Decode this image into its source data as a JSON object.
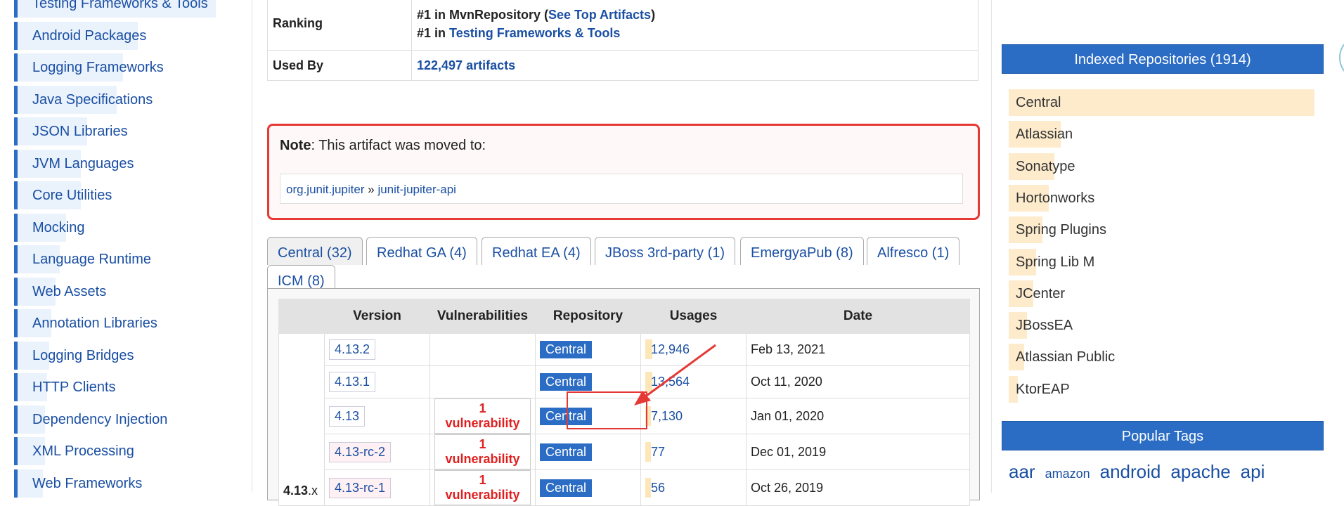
{
  "sidebar": {
    "categories": [
      {
        "label": "Testing Frameworks & Tools",
        "fill": 0.94
      },
      {
        "label": "Android Packages",
        "fill": 0.57
      },
      {
        "label": "Logging Frameworks",
        "fill": 0.5
      },
      {
        "label": "Java Specifications",
        "fill": 0.47
      },
      {
        "label": "JSON Libraries",
        "fill": 0.33
      },
      {
        "label": "JVM Languages",
        "fill": 0.3
      },
      {
        "label": "Core Utilities",
        "fill": 0.3
      },
      {
        "label": "Mocking",
        "fill": 0.23
      },
      {
        "label": "Language Runtime",
        "fill": 0.2
      },
      {
        "label": "Web Assets",
        "fill": 0.18
      },
      {
        "label": "Annotation Libraries",
        "fill": 0.16
      },
      {
        "label": "Logging Bridges",
        "fill": 0.15
      },
      {
        "label": "HTTP Clients",
        "fill": 0.14
      },
      {
        "label": "Dependency Injection",
        "fill": 0.13
      },
      {
        "label": "XML Processing",
        "fill": 0.13
      },
      {
        "label": "Web Frameworks",
        "fill": 0.12
      }
    ]
  },
  "info": {
    "ranking_label": "Ranking",
    "rank1_prefix": "#1 in MvnRepository (",
    "rank1_link": "See Top Artifacts",
    "rank1_suffix": ")",
    "rank2_prefix": "#1 in",
    "rank2_link": "Testing Frameworks & Tools",
    "usedby_label": "Used By",
    "usedby_value": "122,497 artifacts"
  },
  "note": {
    "label": "Note",
    "text": ": This artifact was moved to:",
    "group": "org.junit.jupiter",
    "sep": "»",
    "artifact": "junit-jupiter-api"
  },
  "tabs": [
    "Central (32)",
    "Redhat GA (4)",
    "Redhat EA (4)",
    "JBoss 3rd-party (1)",
    "EmergyaPub (8)",
    "Alfresco (1)",
    "ICM (8)"
  ],
  "versions": {
    "headers": [
      "Version",
      "Vulnerabilities",
      "Repository",
      "Usages",
      "Date"
    ],
    "group_label": "4.13.x",
    "group_bold": "4.13",
    "group_suffix": ".x",
    "rows": [
      {
        "version": "4.13.2",
        "vuln": "",
        "repo": "Central",
        "usages": "12,946",
        "usage_fill": 0.07,
        "date": "Feb 13, 2021",
        "rc": false
      },
      {
        "version": "4.13.1",
        "vuln": "",
        "repo": "Central",
        "usages": "13,564",
        "usage_fill": 0.07,
        "date": "Oct 11, 2020",
        "rc": false
      },
      {
        "version": "4.13",
        "vuln": "1 vulnerability",
        "repo": "Central",
        "usages": "7,130",
        "usage_fill": 0.04,
        "date": "Jan 01, 2020",
        "rc": false
      },
      {
        "version": "4.13-rc-2",
        "vuln": "1 vulnerability",
        "repo": "Central",
        "usages": "77",
        "usage_fill": 0.02,
        "date": "Dec 01, 2019",
        "rc": true
      },
      {
        "version": "4.13-rc-1",
        "vuln": "1 vulnerability",
        "repo": "Central",
        "usages": "56",
        "usage_fill": 0.02,
        "date": "Oct 26, 2019",
        "rc": true
      }
    ]
  },
  "right": {
    "indexed_title": "Indexed Repositories (1914)",
    "repos": [
      {
        "name": "Central",
        "fill": 1.0
      },
      {
        "name": "Atlassian",
        "fill": 0.17
      },
      {
        "name": "Sonatype",
        "fill": 0.15
      },
      {
        "name": "Hortonworks",
        "fill": 0.13
      },
      {
        "name": "Spring Plugins",
        "fill": 0.11
      },
      {
        "name": "Spring Lib M",
        "fill": 0.09
      },
      {
        "name": "JCenter",
        "fill": 0.08
      },
      {
        "name": "JBossEA",
        "fill": 0.06
      },
      {
        "name": "Atlassian Public",
        "fill": 0.05
      },
      {
        "name": "KtorEAP",
        "fill": 0.03
      }
    ],
    "tags_title": "Popular Tags",
    "tags": [
      {
        "name": "aar",
        "size": 26
      },
      {
        "name": "amazon",
        "size": 18
      },
      {
        "name": "android",
        "size": 26
      },
      {
        "name": "apache",
        "size": 26
      },
      {
        "name": "api",
        "size": 26
      }
    ]
  },
  "colors": {
    "accent": "#2b6cc4",
    "link": "#1a4fa3",
    "danger": "#e53935"
  }
}
